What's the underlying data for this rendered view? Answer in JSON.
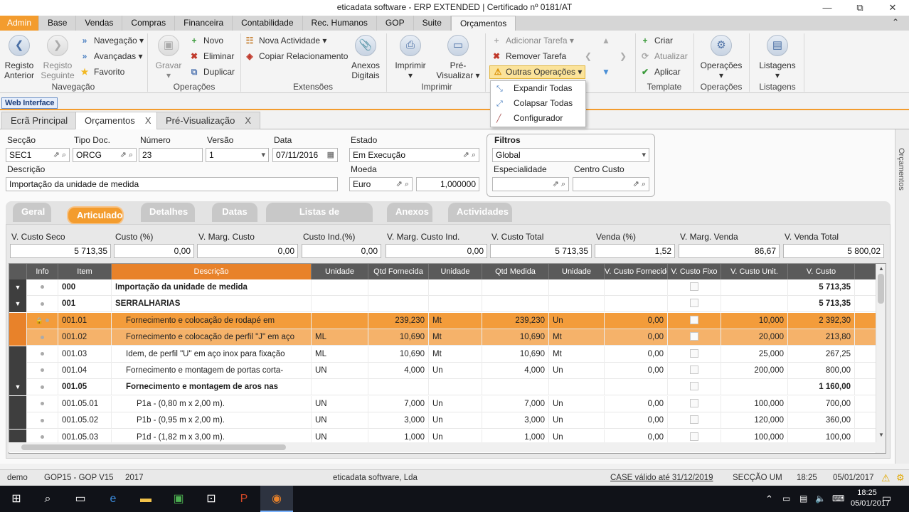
{
  "window": {
    "title": "eticadata software - ERP EXTENDED | Certificado nº 0181/AT",
    "min": "—",
    "max": "⧉",
    "close": "✕"
  },
  "menu": [
    "Admin",
    "Base",
    "Vendas",
    "Compras",
    "Financeira",
    "Contabilidade",
    "Rec. Humanos",
    "GOP",
    "Suite",
    "Orçamentos"
  ],
  "ribbon": {
    "nav": {
      "prev": "Registo Anterior",
      "next": "Registo Seguinte",
      "navegacao": "Navegação",
      "avancadas": "Avançadas",
      "favorito": "Favorito",
      "label": "Navegação"
    },
    "ops": {
      "gravar": "Gravar",
      "novo": "Novo",
      "eliminar": "Eliminar",
      "duplicar": "Duplicar",
      "label": "Operações"
    },
    "ext": {
      "nova": "Nova Actividade",
      "copiar": "Copiar Relacionamento",
      "anexos": "Anexos Digitais",
      "label": "Extensões"
    },
    "print": {
      "imprimir": "Imprimir",
      "pre": "Pré-Visualizar",
      "label": "Imprimir"
    },
    "tasks": {
      "add": "Adicionar Tarefa",
      "remove": "Remover Tarefa",
      "outras": "Outras Operações"
    },
    "template": {
      "criar": "Criar",
      "atualizar": "Atualizar",
      "aplicar": "Aplicar",
      "label": "Template"
    },
    "operacoes": {
      "btn": "Operações",
      "label": "Operações"
    },
    "listagens": {
      "btn": "Listagens",
      "label": "Listagens"
    }
  },
  "dropdown": [
    "Expandir Todas",
    "Colapsar Todas",
    "Configurador"
  ],
  "web_interface": "Web Interface",
  "doc_tabs": [
    "Ecrã Principal",
    "Orçamentos",
    "Pré-Visualização"
  ],
  "doc_tab_close": "X",
  "side_label": "Orçamentos",
  "form": {
    "seccao_label": "Secção",
    "seccao": "SEC1",
    "tipodoc_label": "Tipo Doc.",
    "tipodoc": "ORCG",
    "numero_label": "Número",
    "numero": "23",
    "versao_label": "Versão",
    "versao": "1",
    "data_label": "Data",
    "data": "07/11/2016",
    "estado_label": "Estado",
    "estado": "Em Execução",
    "descricao_label": "Descrição",
    "descricao": "Importação da unidade de medida",
    "moeda_label": "Moeda",
    "moeda": "Euro",
    "cambio": "1,000000",
    "filtros_label": "Filtros",
    "filtros": "Global",
    "especialidade_label": "Especialidade",
    "centro_label": "Centro Custo"
  },
  "section_tabs": [
    "Geral",
    "Articulado",
    "Detalhes",
    "Datas",
    "Listas de Verificação",
    "Anexos",
    "Actividades"
  ],
  "totals": {
    "labels": [
      "V. Custo Seco",
      "Custo (%)",
      "V. Marg. Custo",
      "Custo Ind.(%)",
      "V. Marg. Custo Ind.",
      "V. Custo Total",
      "Venda (%)",
      "V. Marg. Venda",
      "V. Venda Total"
    ],
    "values": [
      "5 713,35",
      "0,00",
      "0,00",
      "0,00",
      "0,00",
      "5 713,35",
      "1,52",
      "86,67",
      "5 800,02"
    ]
  },
  "grid": {
    "headers": [
      "",
      "Info",
      "Item",
      "Descrição",
      "Unidade",
      "Qtd Fornecida",
      "Unidade",
      "Qtd Medida",
      "Unidade",
      "V. Custo Fornecido",
      "V. Custo Fixo",
      "V. Custo Unit.",
      "V. Custo"
    ],
    "rows": [
      {
        "item": "000",
        "desc": "Importação da unidade de medida",
        "un1": "",
        "qf": "",
        "un2": "",
        "qm": "",
        "un3": "",
        "vcf": "",
        "vcu": "",
        "vc": "5 713,35",
        "bold": true,
        "expand": true
      },
      {
        "item": "001",
        "desc": "SERRALHARIAS",
        "un1": "",
        "qf": "",
        "un2": "",
        "qm": "",
        "un3": "",
        "vcf": "",
        "vcu": "",
        "vc": "5 713,35",
        "bold": true,
        "expand": true
      },
      {
        "item": "001.01",
        "desc": "Fornecimento e colocação de rodapé em",
        "un1": "",
        "qf": "239,230",
        "un2": "Mt",
        "qm": "239,230",
        "un3": "Un",
        "vcf": "0,00",
        "vcu": "10,000",
        "vc": "2 392,30",
        "sel": 1
      },
      {
        "item": "001.02",
        "desc": "Fornecimento e colocação de perfil \"J\" em aço",
        "un1": "ML",
        "qf": "10,690",
        "un2": "Mt",
        "qm": "10,690",
        "un3": "Mt",
        "vcf": "0,00",
        "vcu": "20,000",
        "vc": "213,80",
        "sel": 2
      },
      {
        "item": "001.03",
        "desc": "Idem, de perfil \"U\" em aço inox para fixação",
        "un1": "ML",
        "qf": "10,690",
        "un2": "Mt",
        "qm": "10,690",
        "un3": "Mt",
        "vcf": "0,00",
        "vcu": "25,000",
        "vc": "267,25"
      },
      {
        "item": "001.04",
        "desc": "Fornecimento e montagem de portas corta-",
        "un1": "UN",
        "qf": "4,000",
        "un2": "Un",
        "qm": "4,000",
        "un3": "Un",
        "vcf": "0,00",
        "vcu": "200,000",
        "vc": "800,00"
      },
      {
        "item": "001.05",
        "desc": "Fornecimento e montagem de aros nas",
        "un1": "",
        "qf": "",
        "un2": "",
        "qm": "",
        "un3": "",
        "vcf": "",
        "vcu": "",
        "vc": "1 160,00",
        "bold": true,
        "expand": true
      },
      {
        "item": "001.05.01",
        "desc": "P1a - (0,80 m x 2,00 m).",
        "un1": "UN",
        "qf": "7,000",
        "un2": "Un",
        "qm": "7,000",
        "un3": "Un",
        "vcf": "0,00",
        "vcu": "100,000",
        "vc": "700,00"
      },
      {
        "item": "001.05.02",
        "desc": "P1b - (0,95 m x 2,00 m).",
        "un1": "UN",
        "qf": "3,000",
        "un2": "Un",
        "qm": "3,000",
        "un3": "Un",
        "vcf": "0,00",
        "vcu": "120,000",
        "vc": "360,00"
      },
      {
        "item": "001.05.03",
        "desc": "P1d - (1,82 m x 3,00 m).",
        "un1": "UN",
        "qf": "1,000",
        "un2": "Un",
        "qm": "1,000",
        "un3": "Un",
        "vcf": "0,00",
        "vcu": "100,000",
        "vc": "100,00"
      }
    ]
  },
  "status": {
    "user": "demo",
    "gop": "GOP15 - GOP V15",
    "year": "2017",
    "company": "eticadata software, Lda",
    "case": "CASE válido até 31/12/2019",
    "secao": "SECÇÃO UM",
    "time": "18:25",
    "date": "05/01/2017"
  },
  "taskbar": {
    "time": "18:25",
    "date": "05/01/2017"
  },
  "colors": {
    "accent": "#f39c2e",
    "selected_row": "#f39c3b",
    "header_bg": "#5a5a5a"
  }
}
